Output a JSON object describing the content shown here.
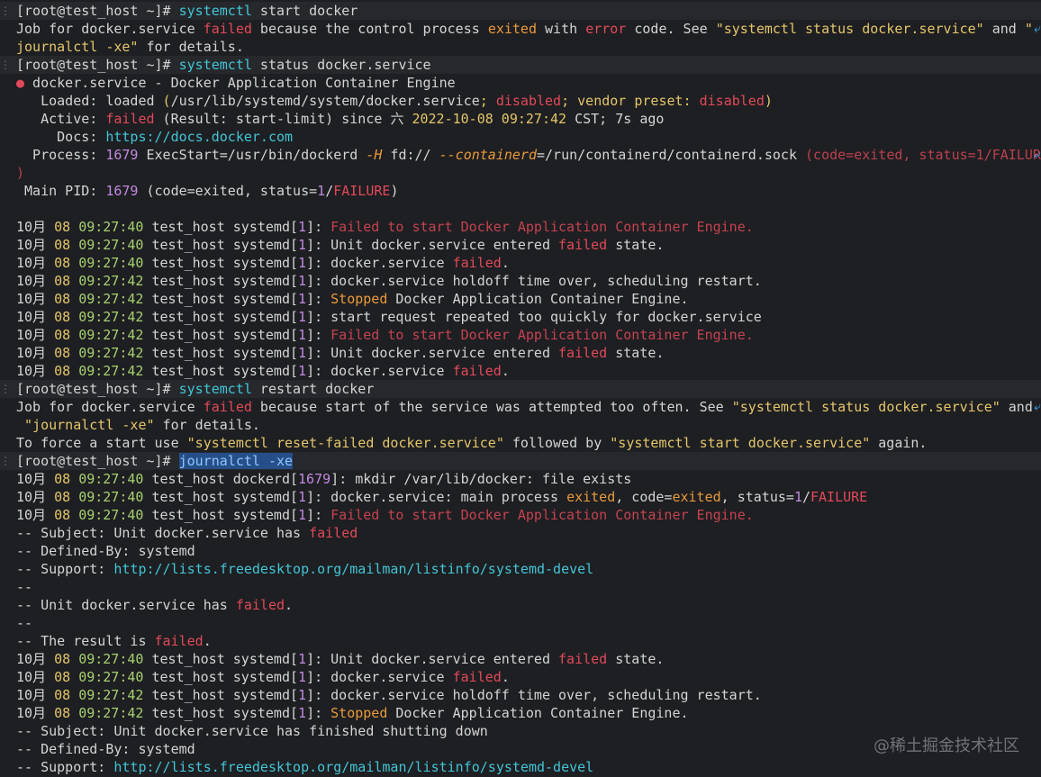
{
  "watermark": "@稀土掘金技术社区",
  "prompt": "[root@test_host ~]#",
  "cmd1": {
    "c": "systemctl",
    "rest": " start docker"
  },
  "l2": {
    "a": "Job for docker.service ",
    "failed": "failed",
    "b": " because the control process ",
    "exited": "exited",
    "c": " with ",
    "error": "error",
    "d": " code. See ",
    "q1": "\"systemctl status docker.service\"",
    "e": " and ",
    "q2": "\""
  },
  "l3": {
    "q": "journalctl -xe\"",
    "rest": " for details."
  },
  "cmd2": {
    "c": "systemctl",
    "rest": " status docker.service"
  },
  "status": {
    "dot": "●",
    "svc": " docker.service",
    "dash": " - ",
    "desc": "Docker Application Container Engine",
    "loaded_k": "   Loaded: ",
    "loaded_v": "loaded",
    "loaded_p1": " (",
    "loaded_path": "/usr/lib/systemd/system/docker.service",
    "loaded_semi": ";",
    "loaded_dis": " disabled",
    "loaded_vp": "; vendor preset: ",
    "loaded_dis2": "disabled",
    "loaded_end": ")",
    "active_k": "   Active: ",
    "active_v": "failed",
    "active_r": " (Result: start-limit) since ",
    "active_day": "六 ",
    "active_date": "2022-10-08 09:27:42",
    "active_tz": " CST; 7s ago",
    "docs_k": "     Docs: ",
    "docs_v": "https://docs.docker.com",
    "proc_k": "  Process: ",
    "proc_pid": "1679",
    "proc_exec": " ExecStart=/usr/bin/dockerd ",
    "proc_h": "-H",
    "proc_fd": " fd:// ",
    "proc_ct": "--containerd",
    "proc_sock": "=/run/containerd/containerd.sock ",
    "proc_code": "(code=exited, status=1/FAILURE",
    "proc_close": ")",
    "main_k": " Main PID: ",
    "main_pid": "1679",
    "main_rest": " (code=exited, status=",
    "main_one": "1",
    "main_slash": "/",
    "main_fail": "FAILURE",
    "main_end": ")"
  },
  "log1": [
    {
      "time": "09:27:40",
      "unit": "systemd",
      "pid": "1",
      "msg_type": "red",
      "msg": "Failed to start Docker Application Container Engine."
    },
    {
      "time": "09:27:40",
      "unit": "systemd",
      "pid": "1",
      "msg_type": "failedstate",
      "pre": "Unit docker.service entered ",
      "word": "failed",
      "post": " state."
    },
    {
      "time": "09:27:40",
      "unit": "systemd",
      "pid": "1",
      "msg_type": "svcfailed",
      "pre": "docker.service ",
      "word": "failed",
      "post": "."
    },
    {
      "time": "09:27:42",
      "unit": "systemd",
      "pid": "1",
      "msg_type": "plain",
      "msg": "docker.service holdoff time over, scheduling restart."
    },
    {
      "time": "09:27:42",
      "unit": "systemd",
      "pid": "1",
      "msg_type": "stopped",
      "word": "Stopped",
      "post": " Docker Application Container Engine."
    },
    {
      "time": "09:27:42",
      "unit": "systemd",
      "pid": "1",
      "msg_type": "plain",
      "msg": "start request repeated too quickly for docker.service"
    },
    {
      "time": "09:27:42",
      "unit": "systemd",
      "pid": "1",
      "msg_type": "red",
      "msg": "Failed to start Docker Application Container Engine."
    },
    {
      "time": "09:27:42",
      "unit": "systemd",
      "pid": "1",
      "msg_type": "failedstate",
      "pre": "Unit docker.service entered ",
      "word": "failed",
      "post": " state."
    },
    {
      "time": "09:27:42",
      "unit": "systemd",
      "pid": "1",
      "msg_type": "svcfailed",
      "pre": "docker.service ",
      "word": "failed",
      "post": "."
    }
  ],
  "month": "10月",
  "day": "08",
  "host": "test_host",
  "cmd3": {
    "c": "systemctl",
    "rest": " restart docker"
  },
  "l24": {
    "a": "Job for docker.service ",
    "failed": "failed",
    "b": " because start of the service was attempted too often. See ",
    "q1": "\"systemctl status docker.service\"",
    "e": " and"
  },
  "l25": {
    "q": " \"journalctl -xe\"",
    "rest": " for details."
  },
  "l26": {
    "a": "To force a start use ",
    "q1": "\"systemctl reset-failed docker.service\"",
    "b": " followed by ",
    "q2": "\"systemctl start docker.service\"",
    "c": " again."
  },
  "cmd4": {
    "sel": "journalctl -xe"
  },
  "log2": {
    "l1": {
      "time": "09:27:40",
      "unit": "dockerd",
      "pid": "1679",
      "msg": ": mkdir /var/lib/docker: file exists"
    },
    "l2": {
      "time": "09:27:40",
      "unit": "systemd",
      "pid": "1",
      "a": ": docker.service: main process ",
      "exited": "exited",
      "b": ", code=",
      "exited2": "exited",
      "c": ", status=",
      "one": "1",
      "slash": "/",
      "fail": "FAILURE"
    },
    "l3": {
      "time": "09:27:40",
      "unit": "systemd",
      "pid": "1",
      "msg": "Failed to start Docker Application Container Engine."
    }
  },
  "notes1": {
    "subj_k": "-- Subject: ",
    "subj_v": "Unit docker.service has ",
    "subj_f": "failed",
    "def_k": "-- Defined-By: ",
    "def_v": "systemd",
    "sup_k": "-- Support: ",
    "sup_v": "http://lists.freedesktop.org/mailman/listinfo/systemd-devel",
    "dash": "--",
    "unit_a": "-- Unit docker.service has ",
    "unit_f": "failed",
    "unit_b": ".",
    "res_a": "-- The result is ",
    "res_f": "failed",
    "res_b": "."
  },
  "log3": [
    {
      "time": "09:27:40",
      "unit": "systemd",
      "pid": "1",
      "msg_type": "failedstate",
      "pre": "Unit docker.service entered ",
      "word": "failed",
      "post": " state."
    },
    {
      "time": "09:27:40",
      "unit": "systemd",
      "pid": "1",
      "msg_type": "svcfailed",
      "pre": "docker.service ",
      "word": "failed",
      "post": "."
    },
    {
      "time": "09:27:42",
      "unit": "systemd",
      "pid": "1",
      "msg_type": "plain",
      "msg": "docker.service holdoff time over, scheduling restart."
    },
    {
      "time": "09:27:42",
      "unit": "systemd",
      "pid": "1",
      "msg_type": "stopped",
      "word": "Stopped",
      "post": " Docker Application Container Engine."
    }
  ],
  "notes2": {
    "subj_k": "-- Subject: ",
    "subj_v": "Unit docker.service has finished shutting down",
    "def_k": "-- Defined-By: ",
    "def_v": "systemd",
    "sup_k": "-- Support: ",
    "sup_v": "http://lists.freedesktop.org/mailman/listinfo/systemd-devel"
  },
  "glyphs": {
    "wrap": "⤶",
    "gutter_prompt": "⋮"
  },
  "colors": {
    "bg": "#1e1f22",
    "text": "#d4d4d4",
    "command": "#42c5d6",
    "error": "#e2495a",
    "warn": "#e89a3c",
    "quote": "#e3c66b",
    "link": "#42c5d6",
    "number": "#c08ae0",
    "selection": "#264f8a"
  }
}
